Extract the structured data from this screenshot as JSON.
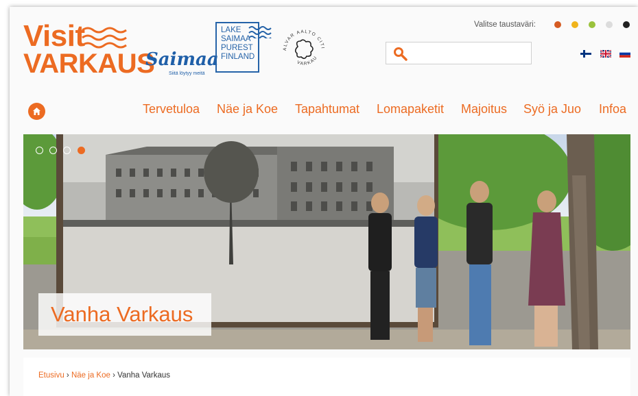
{
  "brand": {
    "line1": "Visit",
    "line2": "VARKAUS"
  },
  "partners": {
    "saimaa": {
      "word": "Saimaa",
      "tagline": "Siitä löytyy meitä"
    },
    "lake_saimaa": {
      "lines": [
        "LAKE",
        "SAIMAA",
        "PUREST",
        "FINLAND"
      ]
    },
    "alvar_aalto": {
      "ring_top": "ALVAR AALTO CITIES",
      "ring_bottom": "VARKAUS"
    }
  },
  "background_picker": {
    "label": "Valitse taustaväri:",
    "colors": [
      "#d55b22",
      "#f0b41c",
      "#9ac23c",
      "#dcdcdc",
      "#222222"
    ]
  },
  "search": {
    "placeholder": ""
  },
  "languages": [
    "fi",
    "en",
    "ru"
  ],
  "nav": {
    "home_icon": "home-icon",
    "items": [
      "Tervetuloa",
      "Näe ja Koe",
      "Tapahtumat",
      "Lomapaketit",
      "Majoitus",
      "Syö ja Juo",
      "Infoa"
    ]
  },
  "hero": {
    "title": "Vanha Varkaus",
    "slides": 4,
    "active_slide": 4
  },
  "breadcrumb": {
    "items": [
      "Etusivu",
      "Näe ja Koe"
    ],
    "separator": "›",
    "current": "Vanha Varkaus"
  },
  "colors": {
    "accent": "#ec6b22",
    "partner_blue": "#1f5fa8"
  }
}
